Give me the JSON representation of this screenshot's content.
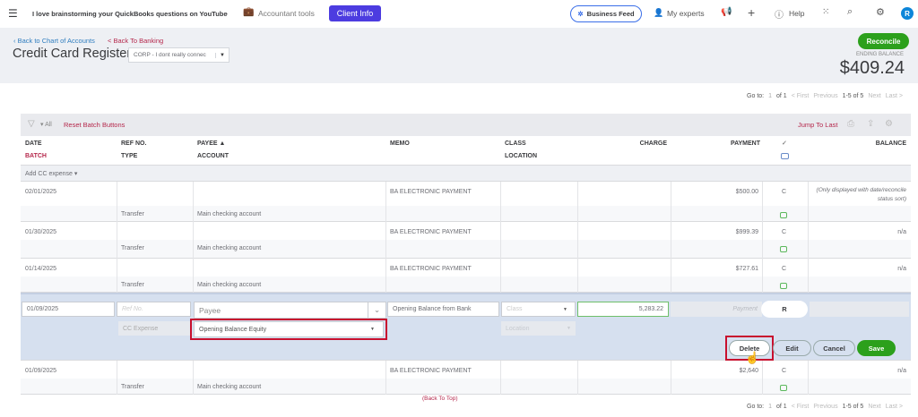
{
  "topbar": {
    "company": "I love brainstorming your QuickBooks questions on YouTube",
    "accountant_tools": "Accountant tools",
    "client_info": "Client Info",
    "business_feed": "Business Feed",
    "my_experts": "My experts",
    "help": "Help",
    "avatar": "R"
  },
  "header": {
    "back_chart": "Back to Chart of Accounts",
    "back_banking": "< Back To Banking",
    "title": "Credit Card Register",
    "account": "CORP - I dont really connec",
    "reconcile": "Reconcile",
    "ending_label": "ENDING BALANCE",
    "ending_balance": "$409.24"
  },
  "pager": {
    "goto": "Go to:",
    "page": "1",
    "of": "of 1",
    "first": "< First",
    "previous": "Previous",
    "range": "1-5 of 5",
    "next": "Next",
    "last": "Last >"
  },
  "toolbar": {
    "all": "All",
    "reset": "Reset Batch Buttons",
    "jump": "Jump To Last"
  },
  "columns": {
    "date": "DATE",
    "batch": "BATCH",
    "ref": "REF NO.",
    "type": "TYPE",
    "payee": "PAYEE ▲",
    "account": "ACCOUNT",
    "memo": "MEMO",
    "class": "CLASS",
    "location": "LOCATION",
    "charge": "CHARGE",
    "payment": "PAYMENT",
    "check": "✓",
    "balance": "BALANCE"
  },
  "add_expense": "Add CC expense",
  "rows": [
    {
      "date": "02/01/2025",
      "type": "Transfer",
      "account": "Main checking account",
      "memo": "BA ELECTRONIC PAYMENT",
      "payment": "$500.00",
      "status": "C",
      "balance": "(Only displayed with date/reconcile status sort)"
    },
    {
      "date": "01/30/2025",
      "type": "Transfer",
      "account": "Main checking account",
      "memo": "BA ELECTRONIC PAYMENT",
      "payment": "$999.39",
      "status": "C",
      "balance": "n/a"
    },
    {
      "date": "01/14/2025",
      "type": "Transfer",
      "account": "Main checking account",
      "memo": "BA ELECTRONIC PAYMENT",
      "payment": "$727.61",
      "status": "C",
      "balance": "n/a"
    },
    {
      "date": "01/09/2025",
      "type": "Transfer",
      "account": "Main checking account",
      "memo": "BA ELECTRONIC PAYMENT",
      "payment": "$2,640",
      "status": "C",
      "balance": "n/a"
    }
  ],
  "edit": {
    "date": "01/09/2025",
    "ref_placeholder": "Ref No.",
    "payee_placeholder": "Payee",
    "memo": "Opening Balance from Bank",
    "class_placeholder": "Class",
    "charge": "5,283.22",
    "payment_placeholder": "Payment",
    "status": "R",
    "type": "CC Expense",
    "account": "Opening Balance Equity",
    "location_placeholder": "Location",
    "delete": "Delete",
    "edit_btn": "Edit",
    "cancel": "Cancel",
    "save": "Save"
  },
  "back_to_top": "(Back To Top)",
  "colors": {
    "green": "#2ca01c",
    "purple": "#4c3ce0",
    "highlight": "#c8102e",
    "edit_bg": "#d6e0ef"
  }
}
